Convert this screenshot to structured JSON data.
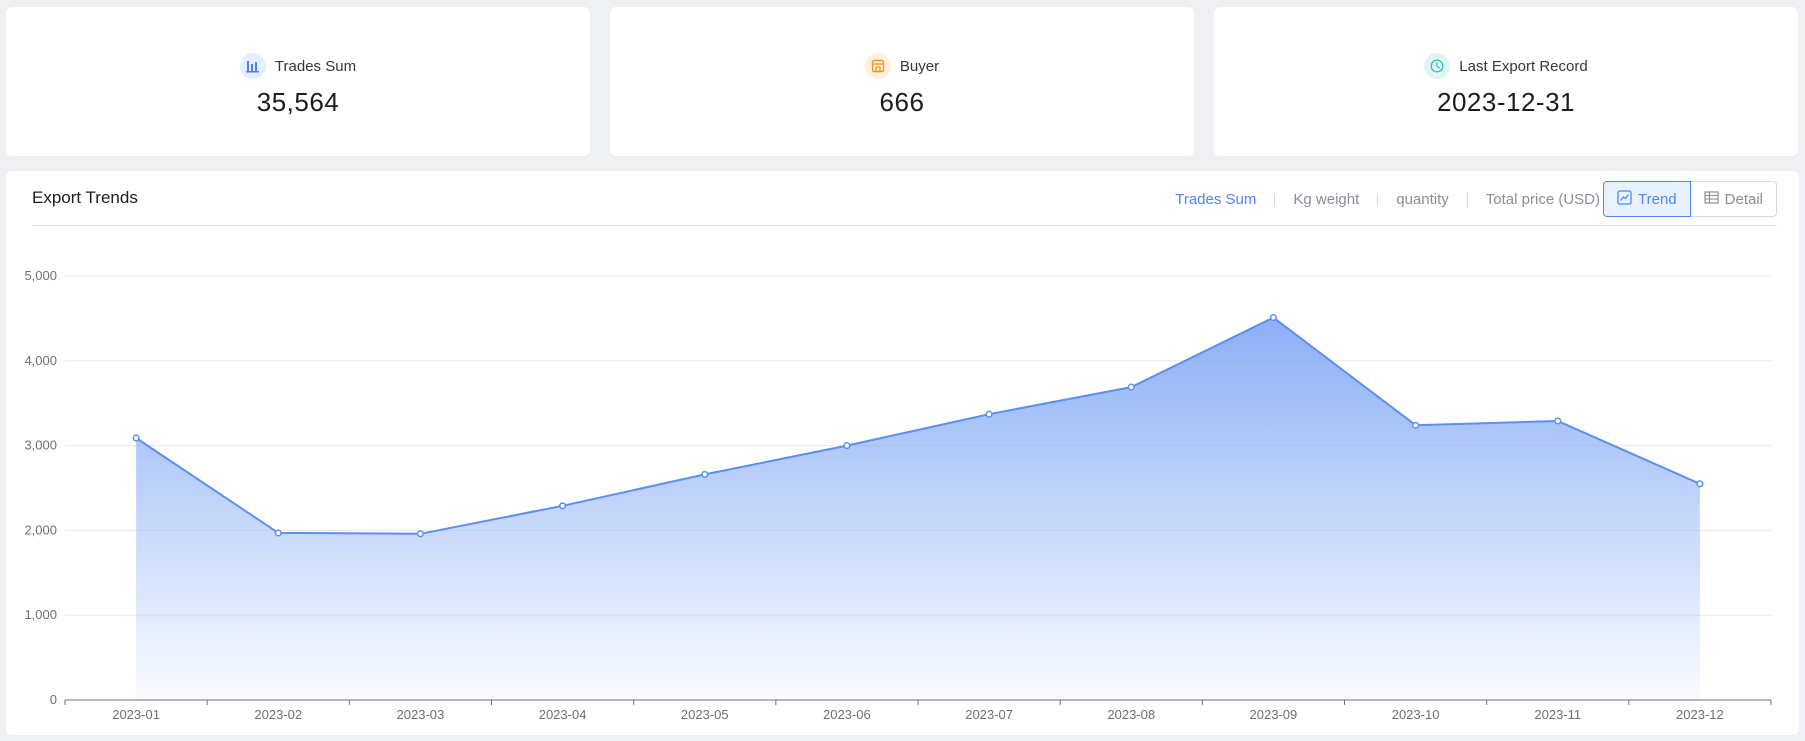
{
  "stats": [
    {
      "label": "Trades Sum",
      "value": "35,564",
      "icon": "bar-chart-icon",
      "icon_color": "#4f7ff0",
      "icon_bg": "#e6eefe"
    },
    {
      "label": "Buyer",
      "value": "666",
      "icon": "store-icon",
      "icon_color": "#f39a1e",
      "icon_bg": "#fdf0de"
    },
    {
      "label": "Last Export Record",
      "value": "2023-12-31",
      "icon": "clock-icon",
      "icon_color": "#2fc1b8",
      "icon_bg": "#e0f6f4"
    }
  ],
  "panel": {
    "title": "Export Trends",
    "metric_tabs": [
      "Trades Sum",
      "Kg weight",
      "quantity",
      "Total price (USD)"
    ],
    "active_metric": "Trades Sum",
    "view_buttons": [
      {
        "label": "Trend",
        "icon": "trend-chart-icon",
        "active": true
      },
      {
        "label": "Detail",
        "icon": "table-icon",
        "active": false
      }
    ]
  },
  "colors": {
    "accent": "#4f86f0",
    "line": "#5b8ff2"
  },
  "chart_data": {
    "type": "area",
    "categories": [
      "2023-01",
      "2023-02",
      "2023-03",
      "2023-04",
      "2023-05",
      "2023-06",
      "2023-07",
      "2023-08",
      "2023-09",
      "2023-10",
      "2023-11",
      "2023-12"
    ],
    "values": [
      3090,
      1970,
      1960,
      2290,
      2660,
      3000,
      3370,
      3690,
      4510,
      3240,
      3290,
      2550
    ],
    "yticks": [
      "0",
      "1,000",
      "2,000",
      "3,000",
      "4,000",
      "5,000"
    ],
    "ylim": [
      0,
      5000
    ],
    "title": "",
    "xlabel": "",
    "ylabel": "",
    "grid": true
  }
}
